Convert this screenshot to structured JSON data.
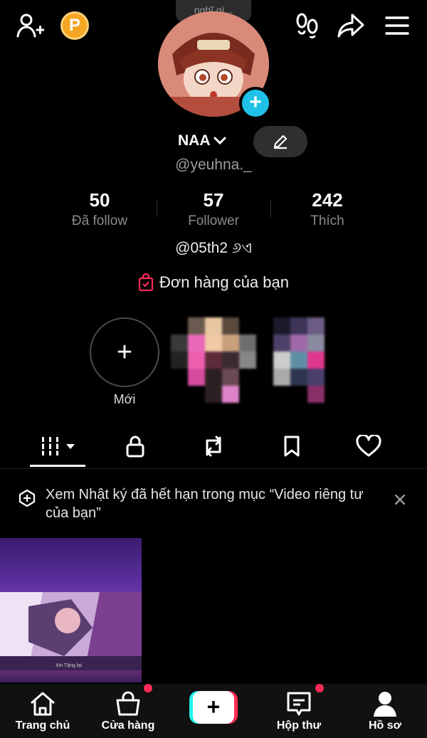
{
  "top_bar": {
    "coin_letter": "P",
    "status_bubble": "nghĩ gì..."
  },
  "profile": {
    "display_name": "NAA",
    "handle": "@yeuhna._",
    "stats": [
      {
        "value": "50",
        "label": "Đã follow"
      },
      {
        "value": "57",
        "label": "Follower"
      },
      {
        "value": "242",
        "label": "Thích"
      }
    ],
    "bio": "@05th2 ୬ଏ",
    "order_link": "Đơn hàng của bạn"
  },
  "stories": {
    "new_label": "Mới"
  },
  "tabs": [
    {
      "icon": "grid-icon"
    },
    {
      "icon": "lock-icon"
    },
    {
      "icon": "repost-icon"
    },
    {
      "icon": "bookmark-icon"
    },
    {
      "icon": "heart-icon"
    }
  ],
  "notice": {
    "text": "Xem Nhật ký đã hết hạn trong mục “Video riêng tư của bạn”"
  },
  "video": {
    "caption": "Xin Tặng lại"
  },
  "bottom_nav": {
    "home": "Trang chủ",
    "shop": "Cửa hàng",
    "inbox": "Hộp thư",
    "profile": "Hồ sơ"
  },
  "colors": {
    "accent_pink": "#fe2c55",
    "accent_cyan": "#25f4ee",
    "coin": "#f5a623",
    "avatar_plus": "#20c1e8"
  }
}
